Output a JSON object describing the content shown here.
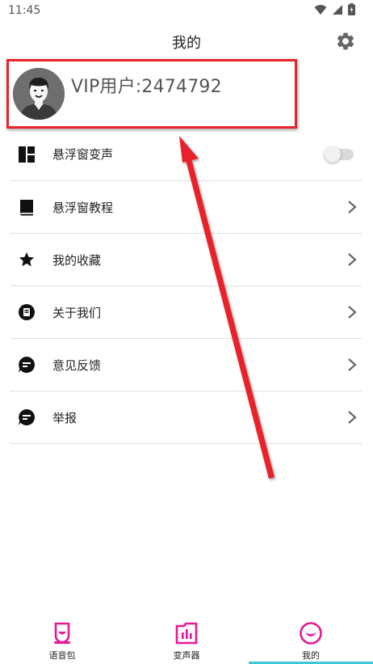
{
  "status_bar": {
    "time": "11:45"
  },
  "header": {
    "title": "我的"
  },
  "profile": {
    "name": "VIP用户:2474792"
  },
  "menu": {
    "items": [
      {
        "label": "悬浮窗变声",
        "icon": "dashboard-icon",
        "control": "toggle",
        "toggle_on": false
      },
      {
        "label": "悬浮窗教程",
        "icon": "book-icon",
        "control": "chevron"
      },
      {
        "label": "我的收藏",
        "icon": "star-icon",
        "control": "chevron"
      },
      {
        "label": "关于我们",
        "icon": "info-badge-icon",
        "control": "chevron"
      },
      {
        "label": "意见反馈",
        "icon": "feedback-chat-icon",
        "control": "chevron"
      },
      {
        "label": "举报",
        "icon": "report-chat-icon",
        "control": "chevron"
      }
    ]
  },
  "bottom_nav": {
    "items": [
      {
        "label": "语音包",
        "icon": "voice-pack-icon"
      },
      {
        "label": "变声器",
        "icon": "voice-changer-icon"
      },
      {
        "label": "我的",
        "icon": "profile-smile-icon",
        "active": true
      }
    ]
  },
  "colors": {
    "accent_magenta": "#e5189a",
    "active_underline": "#3fc7d8",
    "highlight_red": "#e8232a"
  }
}
